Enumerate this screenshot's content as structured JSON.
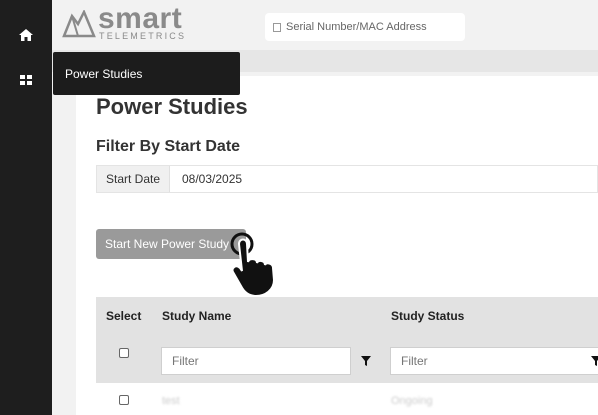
{
  "brand": {
    "word": "smart",
    "sub": "TELEMETRICS"
  },
  "header": {
    "serial_placeholder": "Serial Number/MAC Address"
  },
  "tooltip": {
    "label": "Power Studies"
  },
  "page": {
    "title": "Power Studies",
    "filter_title": "Filter By Start Date",
    "start_date_label": "Start Date",
    "start_date_value": "08/03/2025",
    "start_button": "Start New Power Study"
  },
  "table": {
    "columns": {
      "select": "Select",
      "name": "Study Name",
      "status": "Study Status"
    },
    "filter_placeholder": "Filter",
    "rows": [
      {
        "name": "test",
        "status": "Ongoing"
      }
    ]
  },
  "icons": {
    "rail": [
      "home-icon",
      "grid-icon"
    ],
    "filter": "funnel-icon",
    "cursor": "hand-pointer-icon"
  },
  "colors": {
    "rail": "#1e1e1e",
    "button": "#9a9a9a",
    "table_header": "#e2e2e2"
  }
}
